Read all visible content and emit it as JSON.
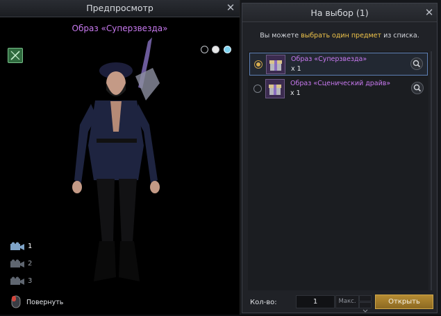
{
  "preview": {
    "title": "Предпросмотр",
    "item_title": "Образ «Суперзвезда»",
    "cameras": [
      {
        "label": "1",
        "active": true
      },
      {
        "label": "2",
        "active": false
      },
      {
        "label": "3",
        "active": false
      }
    ],
    "rotate_label": "Повернуть",
    "color_options": [
      "#000000",
      "#e8e8e8",
      "#7fd3f0"
    ]
  },
  "selection": {
    "title": "На выбор (1)",
    "info_before": "Вы можете ",
    "info_highlight": "выбрать один предмет",
    "info_after": " из списка.",
    "items": [
      {
        "name": "Образ «Суперзвезда»",
        "qty": "x 1",
        "selected": true
      },
      {
        "name": "Образ «Сценический драйв»",
        "qty": "x 1",
        "selected": false
      }
    ],
    "qty_label": "Кол-во:",
    "qty_value": "1",
    "max_label": "Макс.",
    "confirm_label": "Открыть"
  },
  "colors": {
    "item_name": "#c879f0",
    "highlight": "#f1c54a",
    "button": "#b68c33",
    "selected_border": "#5e80b5"
  }
}
